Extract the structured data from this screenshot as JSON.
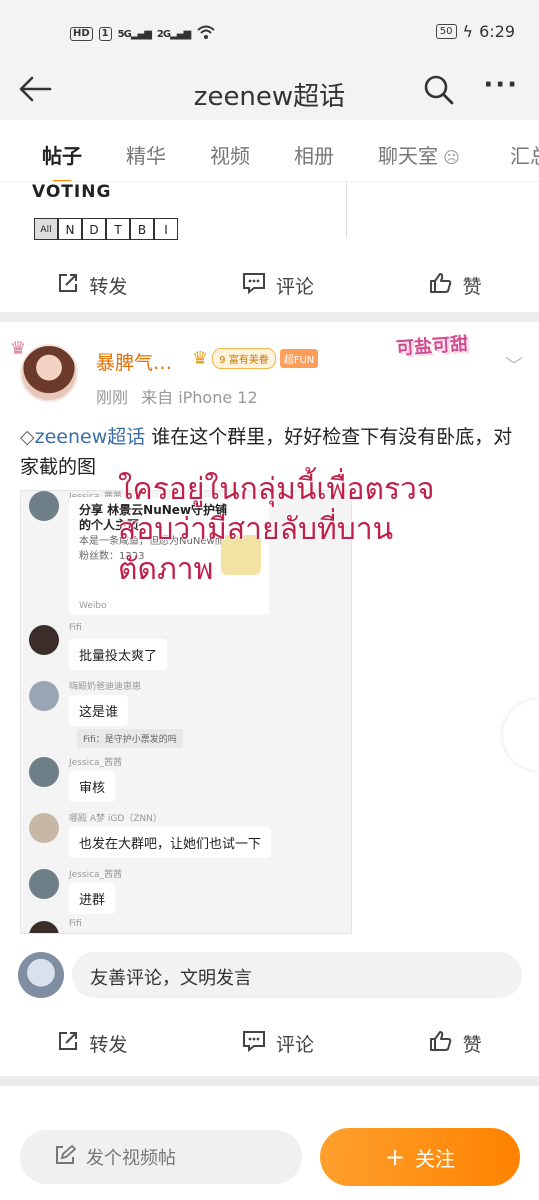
{
  "status_bar": {
    "hd_badge": "HD",
    "sim_badge": "1",
    "signal1": "5G",
    "signal2": "2G",
    "battery": "50",
    "time": "6:29"
  },
  "header": {
    "title": "zeenew超话"
  },
  "tabs": [
    "帖子",
    "精华",
    "视频",
    "相册",
    "聊天室",
    "汇总"
  ],
  "card1": {
    "voting_title": "VOTING",
    "voting_cells": [
      "All",
      "N",
      "D",
      "T",
      "B",
      "I"
    ]
  },
  "actions": {
    "repost": "转发",
    "comment": "评论",
    "like": "赞"
  },
  "post": {
    "username": "暴脾气…",
    "badge_level": "9",
    "badge_rich": "富有美眷",
    "badge_fun": "超FUN",
    "sticker": "可盐可甜",
    "time": "刚刚",
    "source": "来自 iPhone 12",
    "topic": "zeenew超话",
    "text": " 谁在这个群里，好好检查下有没有卧底，对家截的图",
    "overlay_lines": [
      "ใครอยู่ในกลุ่มนี้เพื่อตรวจ",
      "สอบว่ามีสายลับที่บาน",
      "ตัดภาพ"
    ],
    "screenshot": {
      "m1_name": "Jessica_茜茜",
      "card_title": "分享 林景云NuNew守护铺 的个人主页",
      "card_desc": "本是一条咸鱼，但愿为NuNew而战～",
      "card_fans": "粉丝数：1223",
      "card_source": "Weibo",
      "m2_name": "Fifi",
      "m2_text": "批量投太爽了",
      "m3_name": "嗨殿奶爸迪迪崽崽",
      "m3_text": "这是谁",
      "m3_quote": "Fifi：是守护小票发的吗",
      "m4_name": "Jessica_茜茜",
      "m4_text": "审核",
      "m5_name": "哪殿 A梦 iGD（ZNN）",
      "m5_text": "也发在大群吧，让她们也试一下",
      "m6_name": "Jessica_茜茜",
      "m6_text": "进群",
      "m7_name": "Fifi"
    },
    "comment_placeholder": "友善评论，文明发言"
  },
  "bottom_bar": {
    "video_post": "发个视频帖",
    "follow": "关注"
  }
}
